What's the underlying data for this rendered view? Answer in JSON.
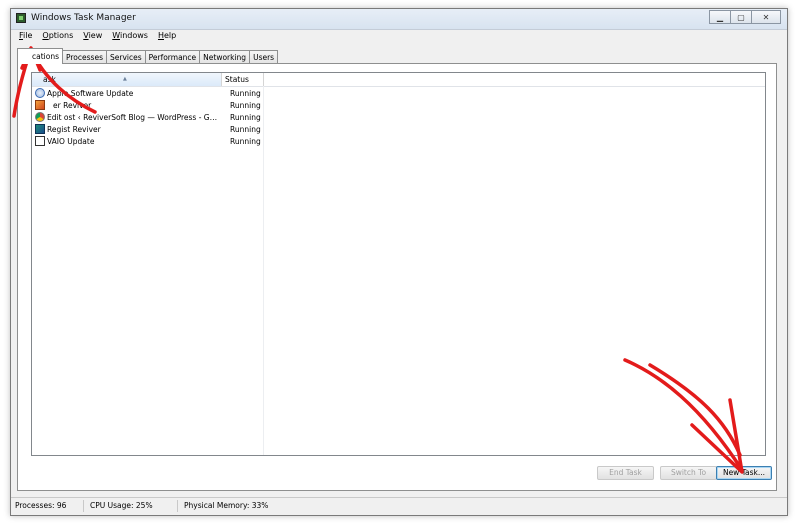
{
  "window": {
    "title": "Windows Task Manager"
  },
  "menu": [
    {
      "ul": "F",
      "rest": "ile"
    },
    {
      "ul": "O",
      "rest": "ptions"
    },
    {
      "ul": "V",
      "rest": "iew"
    },
    {
      "ul": "W",
      "rest": "indows"
    },
    {
      "ul": "H",
      "rest": "elp"
    }
  ],
  "tabs": [
    "cations",
    "Processes",
    "Services",
    "Performance",
    "Networking",
    "Users"
  ],
  "columns": {
    "task": "ask",
    "status": "Status"
  },
  "tasks": [
    {
      "name": "Apple Software Update",
      "status": "Running",
      "icon": "apple-update-icon"
    },
    {
      "name": "er Reviver",
      "status": "Running",
      "icon": "driver-reviver-icon"
    },
    {
      "name": "Edit ost ‹ ReviverSoft Blog — WordPress - Goo...",
      "status": "Running",
      "icon": "chrome-icon"
    },
    {
      "name": "Regist Reviver",
      "status": "Running",
      "icon": "registry-reviver-icon"
    },
    {
      "name": "VAIO Update",
      "status": "Running",
      "icon": "vaio-update-icon"
    }
  ],
  "buttons": {
    "end_task": "End Task",
    "switch_to": "Switch To",
    "new_task": "New Task..."
  },
  "statusbar": {
    "processes": "Processes: 96",
    "cpu": "CPU Usage: 25%",
    "memory": "Physical Memory: 33%"
  },
  "colors": {
    "annotation_red": "#e31b1b",
    "selection_blue": "#dbeaf9"
  }
}
